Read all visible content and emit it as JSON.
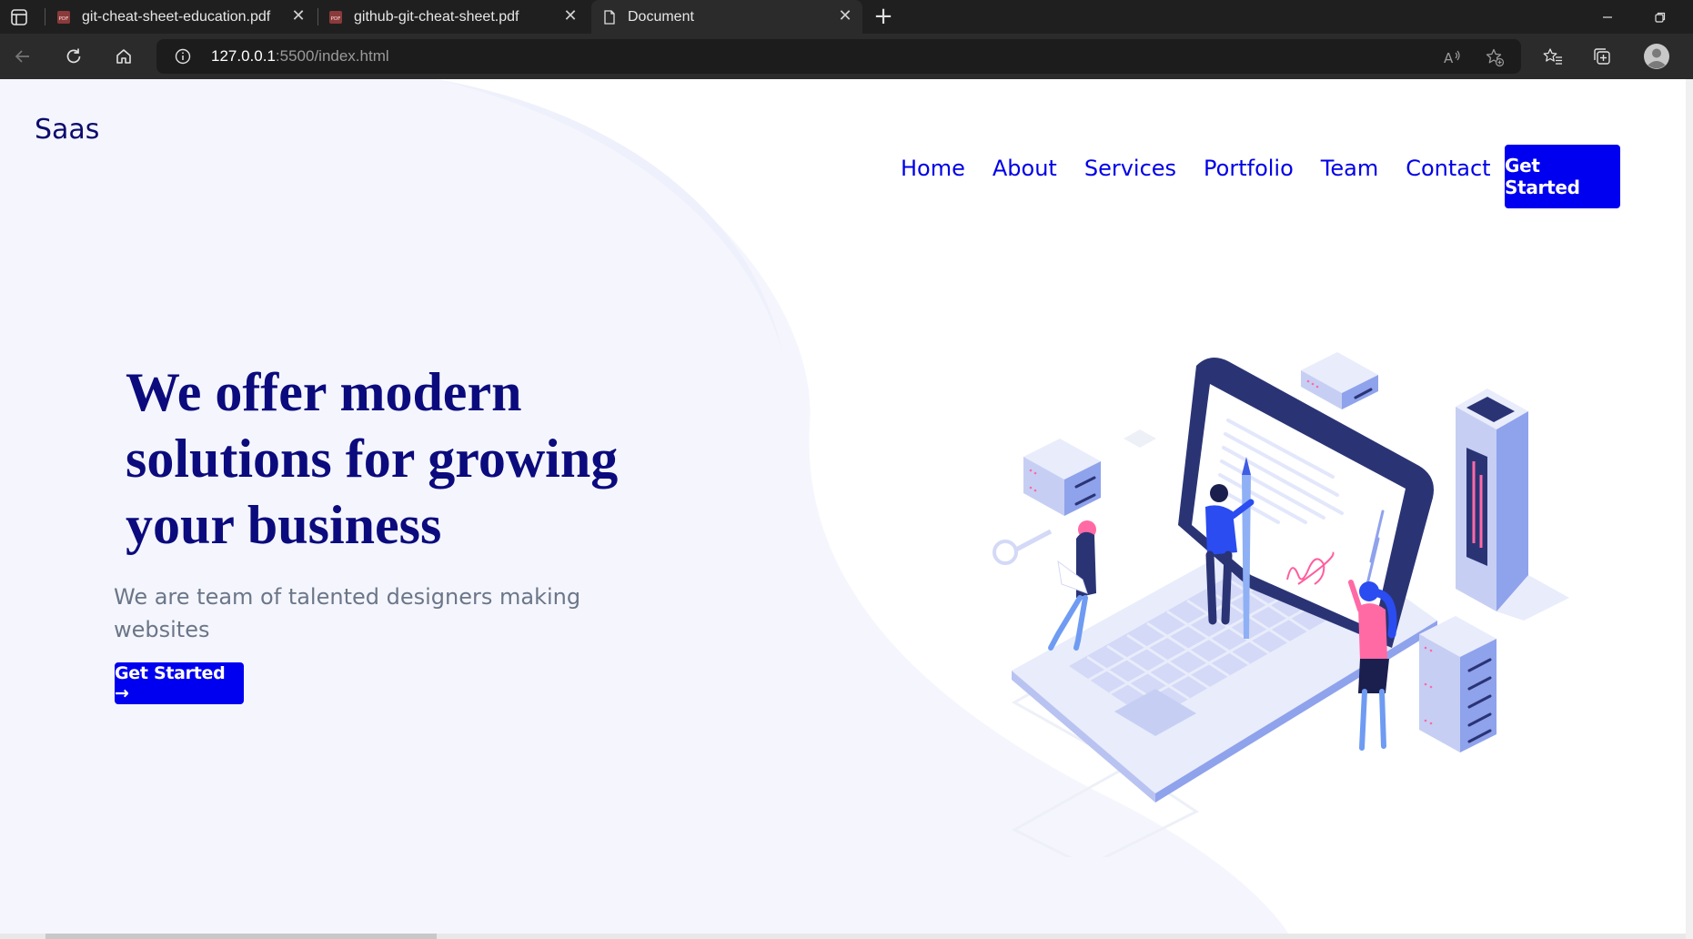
{
  "browser": {
    "tabs": [
      {
        "label": "git-cheat-sheet-education.pdf",
        "icon": "pdf-icon",
        "active": false
      },
      {
        "label": "github-git-cheat-sheet.pdf",
        "icon": "pdf-icon",
        "active": false
      },
      {
        "label": "Document",
        "icon": "document-icon",
        "active": true
      }
    ],
    "address": {
      "host": "127.0.0.1",
      "path": ":5500/index.html"
    }
  },
  "page": {
    "logo": "Saas",
    "nav": {
      "items": [
        "Home",
        "About",
        "Services",
        "Portfolio",
        "Team",
        "Contact"
      ],
      "cta": "Get Started"
    },
    "hero": {
      "title": "We offer modern solutions for growing your business",
      "subtitle": "We are team of talented designers making websites",
      "cta": "Get Started →"
    }
  },
  "colors": {
    "brand_blue": "#0000f0",
    "title_navy": "#0b0b7e",
    "subtitle_gray": "#6b7689",
    "chrome_dark": "#1f1f1f"
  }
}
